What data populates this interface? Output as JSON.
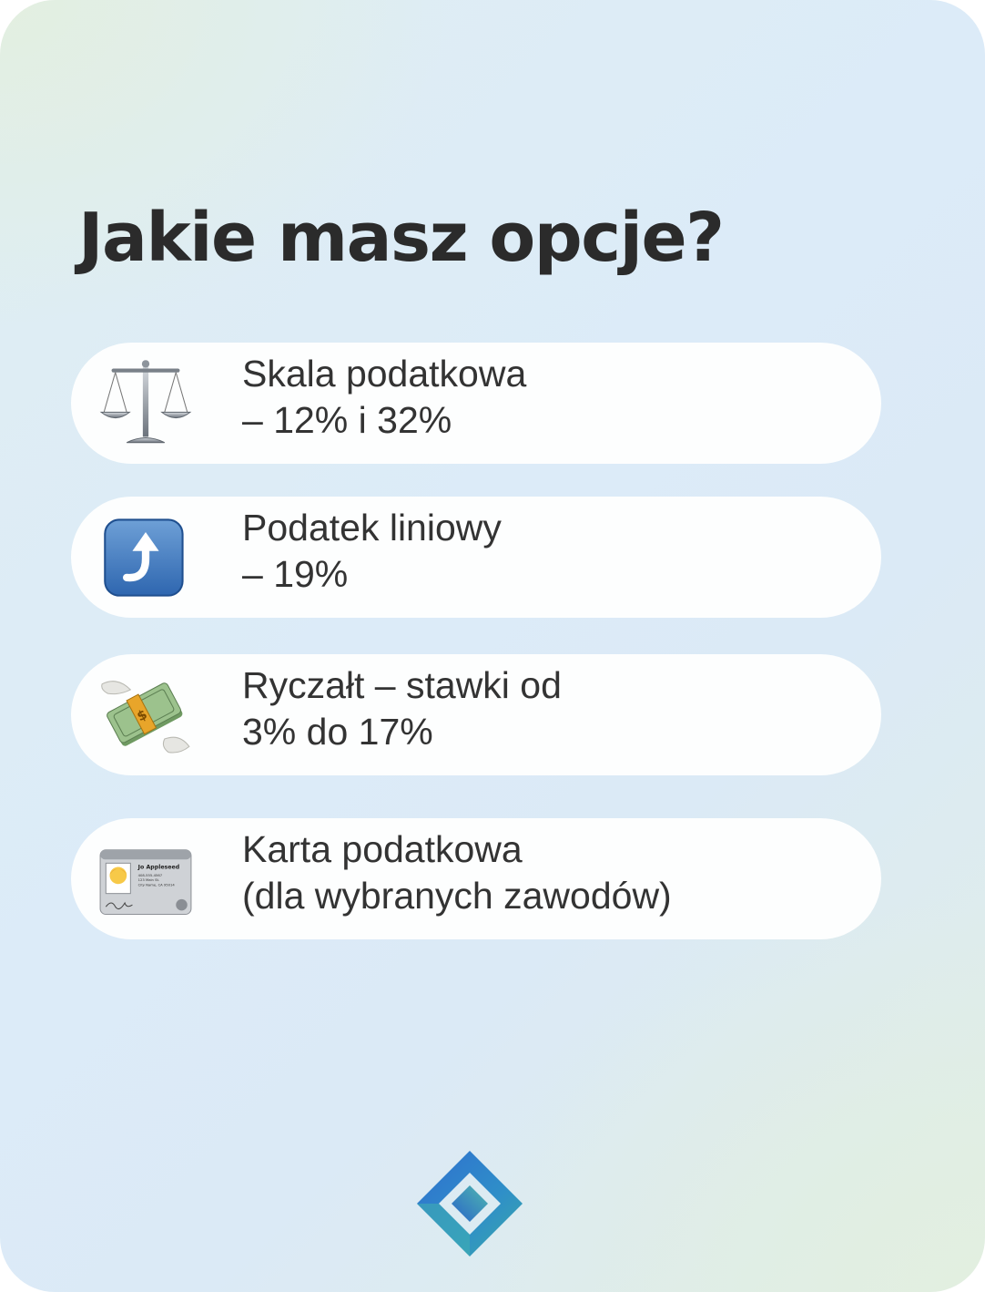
{
  "title": "Jakie masz opcje?",
  "options": [
    {
      "icon": "balance-scale-icon",
      "line1": "Skala podatkowa",
      "line2": "– 12% i 32%"
    },
    {
      "icon": "arrow-curving-up-icon",
      "line1": "Podatek liniowy",
      "line2": "– 19%"
    },
    {
      "icon": "money-with-wings-icon",
      "line1": "Ryczałt – stawki od",
      "line2": "3% do 17%"
    },
    {
      "icon": "id-card-icon",
      "line1": "Karta podatkowa",
      "line2": "(dla wybranych zawodów)",
      "card_name": "Jo Appleseed",
      "card_line1": "408-555-4567",
      "card_line2": "123 Main St.",
      "card_line3": "City Name, CA 95014"
    }
  ],
  "colors": {
    "title": "#2b2b2b",
    "option_text": "#333333",
    "option_background": "#fdfefe",
    "logo_primary": "#2f6fd0",
    "logo_secondary": "#3aa8a8"
  }
}
